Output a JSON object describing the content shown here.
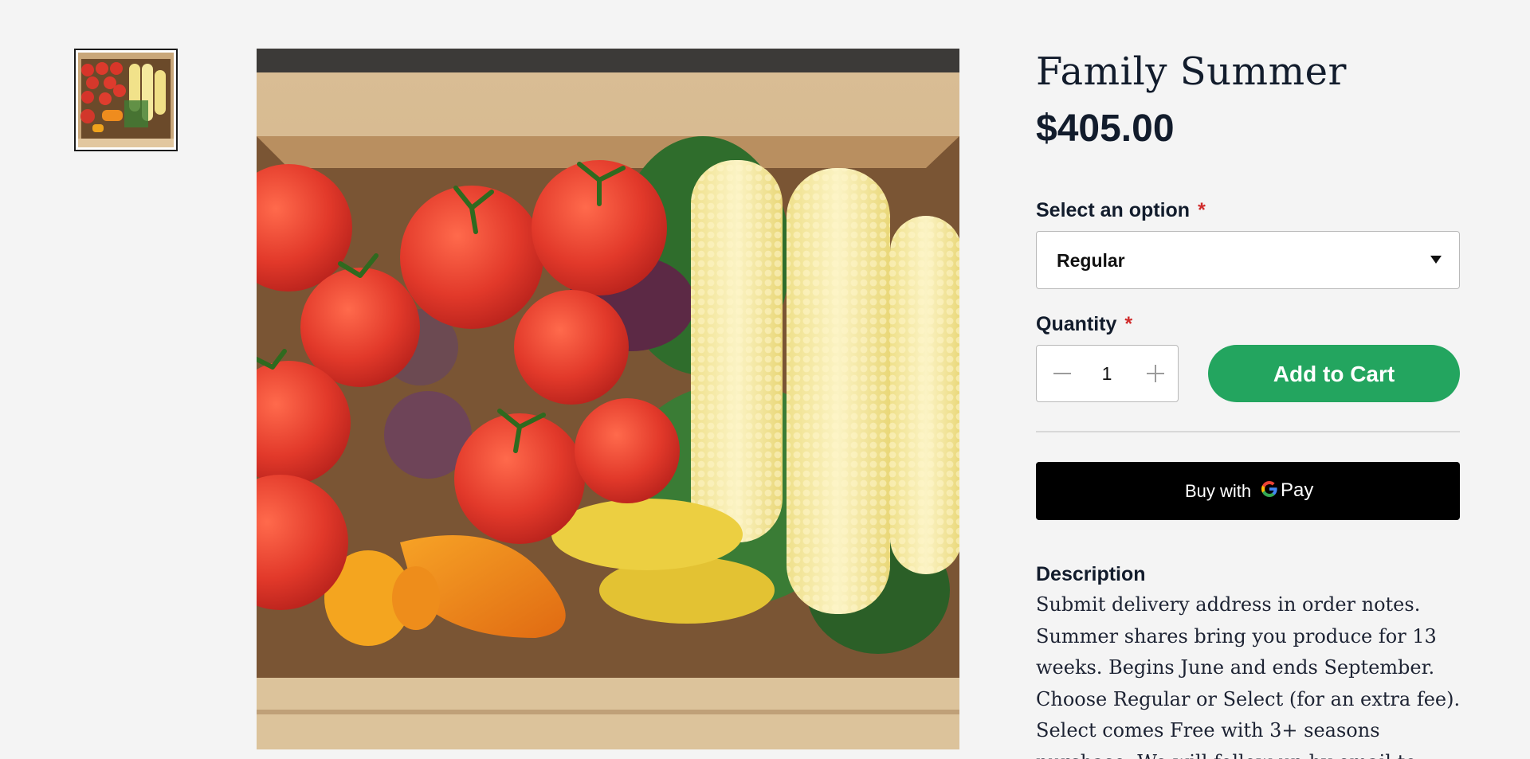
{
  "product": {
    "title": "Family Summer",
    "price": "$405.00",
    "image_alt": "Wooden crate with tomatoes, corn, peppers, beets and squash"
  },
  "options": {
    "label": "Select an option",
    "required_mark": "*",
    "selected": "Regular"
  },
  "quantity": {
    "label": "Quantity",
    "required_mark": "*",
    "value": "1"
  },
  "buttons": {
    "add_to_cart": "Add to Cart",
    "gpay_prefix": "Buy with",
    "gpay_brand": "Pay"
  },
  "description": {
    "heading": "Description",
    "lines": [
      "Submit delivery address in order notes.",
      "Summer shares bring you produce for 13",
      "weeks. Begins June and ends September.",
      "Choose Regular or Select (for an extra fee).",
      "Select comes Free with 3+ seasons",
      "purchase. We will follow up by email to"
    ]
  },
  "colors": {
    "background": "#f4f4f4",
    "accent_green": "#23a55f",
    "required_red": "#d02b2b",
    "text_dark": "#121c2c"
  }
}
